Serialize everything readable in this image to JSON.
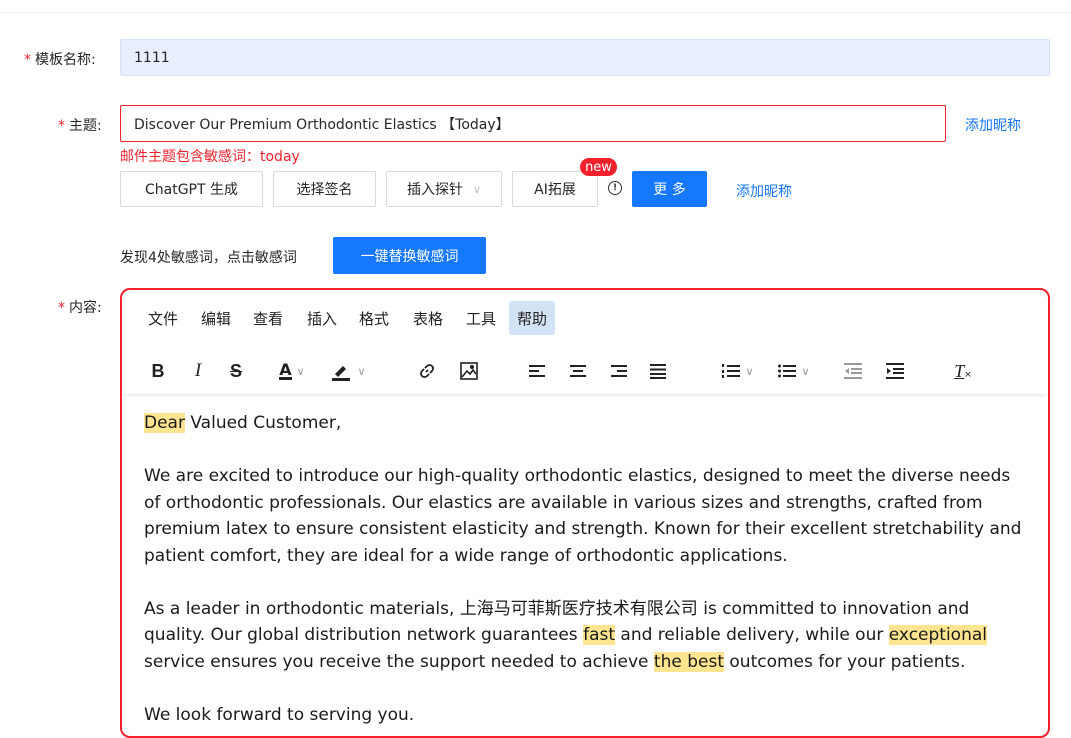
{
  "form": {
    "template_name": {
      "label": "模板名称:",
      "value": "1111"
    },
    "subject": {
      "label": "主题:",
      "value": "Discover Our Premium Orthodontic Elastics 【Today】",
      "add_nickname": "添加昵称",
      "error": "邮件主题包含敏感词：today"
    },
    "actions": {
      "chatgpt": "ChatGPT 生成",
      "signature": "选择签名",
      "probe": "插入探针",
      "ai_expand": "AI拓展",
      "new_badge": "new",
      "more": "更 多",
      "add_nickname": "添加昵称"
    },
    "sensitive": {
      "hint": "发现4处敏感词，点击敏感词",
      "replace_button": "一键替换敏感词"
    },
    "content_label": "内容:"
  },
  "editor": {
    "menu": [
      "文件",
      "编辑",
      "查看",
      "插入",
      "格式",
      "表格",
      "工具",
      "帮助"
    ],
    "active_menu": "帮助",
    "toolbar_icons": [
      "bold-icon",
      "italic-icon",
      "strikethrough-icon",
      "text-color-icon",
      "highlight-color-icon",
      "link-icon",
      "image-icon",
      "align-left-icon",
      "align-center-icon",
      "align-right-icon",
      "justify-icon",
      "numbered-list-icon",
      "bullet-list-icon",
      "outdent-icon",
      "indent-icon",
      "clear-format-icon"
    ],
    "body": {
      "greeting_hl": "Dear",
      "greeting_rest": " Valued Customer,",
      "para1": "We are excited to introduce our high-quality orthodontic elastics, designed to meet the diverse needs of orthodontic professionals. Our elastics are available in various sizes and strengths, crafted from premium latex to ensure consistent elasticity and strength. Known for their excellent stretchability and patient comfort, they are ideal for a wide range of orthodontic applications.",
      "para2_a": "As a leader in orthodontic materials, 上海马可菲斯医疗技术有限公司 is committed to innovation and quality. Our global distribution network guarantees ",
      "para2_hl1": "fast",
      "para2_b": " and reliable delivery, while our ",
      "para2_hl2": "exceptional",
      "para2_c": " service ensures you receive the support needed to achieve ",
      "para2_hl3": "the best",
      "para2_d": " outcomes for your patients.",
      "para3": "We look forward to serving you."
    }
  },
  "colors": {
    "primary": "#1677ff",
    "error": "#f5222d",
    "highlight": "#ffe58f",
    "menu_active": "#d3e2f5"
  }
}
